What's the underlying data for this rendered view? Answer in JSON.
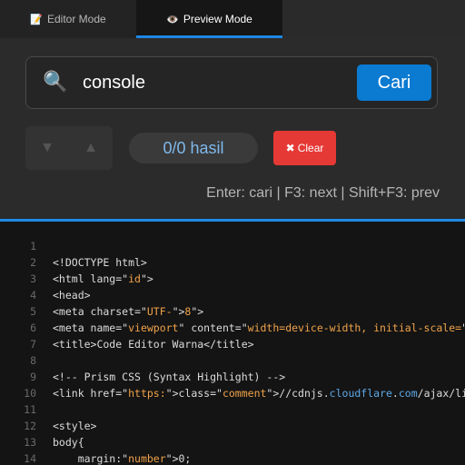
{
  "tabs": {
    "editor": {
      "icon": "📝",
      "label": "Editor Mode"
    },
    "preview": {
      "icon": "👁️",
      "label": "Preview Mode"
    }
  },
  "search": {
    "value": "console",
    "button_label": "Cari",
    "result_count": "0/0 hasil",
    "clear_label": "Clear",
    "clear_symbol": "✖",
    "hint": "Enter: cari | F3: next | Shift+F3: prev",
    "prev_icon": "▼",
    "next_icon": "▲"
  },
  "code_lines": [
    {
      "n": "1",
      "parts": []
    },
    {
      "n": "2",
      "parts": [
        {
          "t": "<!DOCTYPE html>",
          "c": ""
        }
      ]
    },
    {
      "n": "3",
      "parts": [
        {
          "t": "<html lang=\"",
          "c": ""
        },
        {
          "t": "id",
          "c": "s"
        },
        {
          "t": "\">",
          "c": ""
        }
      ]
    },
    {
      "n": "4",
      "parts": [
        {
          "t": "<head>",
          "c": ""
        }
      ]
    },
    {
      "n": "5",
      "parts": [
        {
          "t": "<meta charset=\"",
          "c": ""
        },
        {
          "t": "UTF-",
          "c": "s"
        },
        {
          "t": "\">",
          "c": ""
        },
        {
          "t": "8",
          "c": "s"
        },
        {
          "t": "\">",
          "c": ""
        }
      ]
    },
    {
      "n": "6",
      "parts": [
        {
          "t": "<meta name=\"",
          "c": ""
        },
        {
          "t": "viewport",
          "c": "s"
        },
        {
          "t": "\" content=\"",
          "c": ""
        },
        {
          "t": "width=device-width, initial-scale=",
          "c": "s"
        },
        {
          "t": "\">",
          "c": ""
        }
      ]
    },
    {
      "n": "7",
      "parts": [
        {
          "t": "<title>Code Editor Warna</title>",
          "c": ""
        }
      ]
    },
    {
      "n": "8",
      "parts": []
    },
    {
      "n": "9",
      "parts": [
        {
          "t": "<!-- Prism CSS (Syntax Highlight) -->",
          "c": ""
        }
      ]
    },
    {
      "n": "10",
      "parts": [
        {
          "t": "<link href=\"",
          "c": ""
        },
        {
          "t": "https:",
          "c": "s"
        },
        {
          "t": "\">class=\"",
          "c": ""
        },
        {
          "t": "comment",
          "c": "s"
        },
        {
          "t": "\">//cdnjs.",
          "c": ""
        },
        {
          "t": "cloudflare",
          "c": "b"
        },
        {
          "t": ".",
          "c": ""
        },
        {
          "t": "com",
          "c": "b"
        },
        {
          "t": "/ajax/lib",
          "c": ""
        }
      ]
    },
    {
      "n": "11",
      "parts": []
    },
    {
      "n": "12",
      "parts": [
        {
          "t": "<style>",
          "c": ""
        }
      ]
    },
    {
      "n": "13",
      "parts": [
        {
          "t": "body{",
          "c": ""
        }
      ]
    },
    {
      "n": "14",
      "parts": [
        {
          "t": "    margin:\"",
          "c": ""
        },
        {
          "t": "number",
          "c": "s"
        },
        {
          "t": "\">0;",
          "c": ""
        }
      ]
    }
  ],
  "colors": {
    "accent": "#1e88e5",
    "search_button": "#0b7ad1",
    "clear_button": "#e53935",
    "string": "#f0a24a",
    "link": "#5ea8e6"
  }
}
